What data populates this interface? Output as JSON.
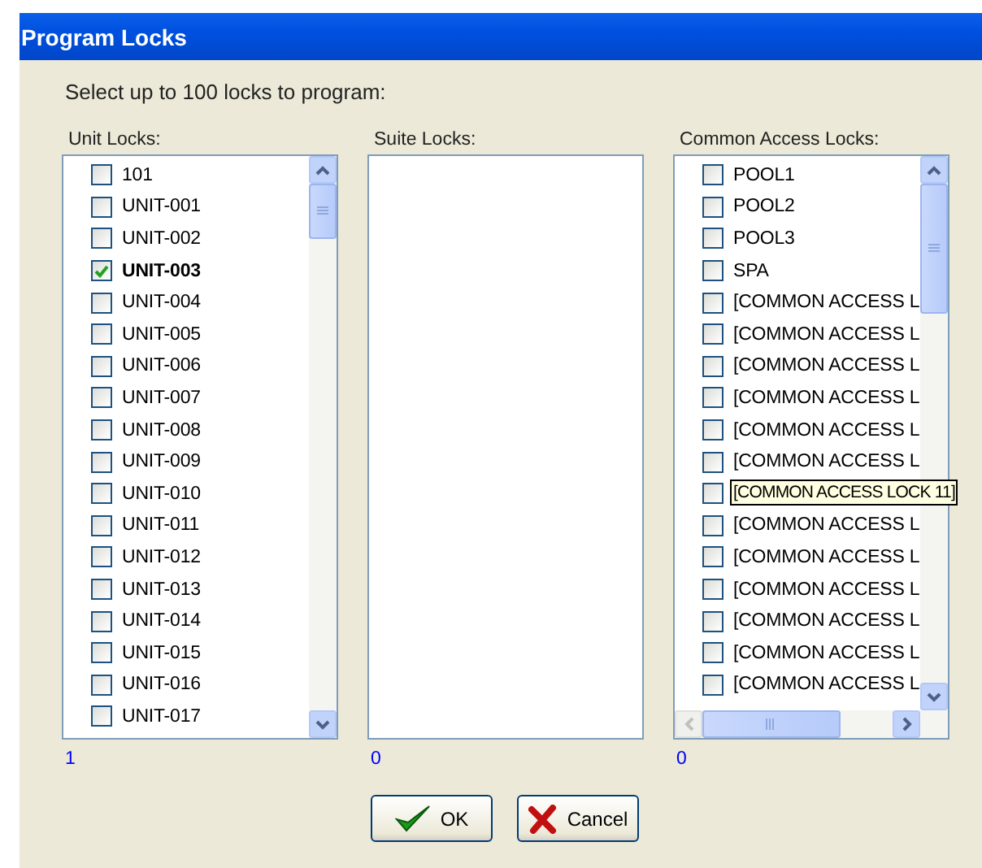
{
  "window": {
    "title": "Program Locks"
  },
  "prompt": "Select up to 100 locks to program:",
  "lists": [
    {
      "label": "Unit Locks:",
      "count": "1",
      "scrollbar": true,
      "horizontal_scrollbar": false,
      "items": [
        {
          "label": "101",
          "checked": false
        },
        {
          "label": "UNIT-001",
          "checked": false
        },
        {
          "label": "UNIT-002",
          "checked": false
        },
        {
          "label": "UNIT-003",
          "checked": true
        },
        {
          "label": "UNIT-004",
          "checked": false
        },
        {
          "label": "UNIT-005",
          "checked": false
        },
        {
          "label": "UNIT-006",
          "checked": false
        },
        {
          "label": "UNIT-007",
          "checked": false
        },
        {
          "label": "UNIT-008",
          "checked": false
        },
        {
          "label": "UNIT-009",
          "checked": false
        },
        {
          "label": "UNIT-010",
          "checked": false
        },
        {
          "label": "UNIT-011",
          "checked": false
        },
        {
          "label": "UNIT-012",
          "checked": false
        },
        {
          "label": "UNIT-013",
          "checked": false
        },
        {
          "label": "UNIT-014",
          "checked": false
        },
        {
          "label": "UNIT-015",
          "checked": false
        },
        {
          "label": "UNIT-016",
          "checked": false
        },
        {
          "label": "UNIT-017",
          "checked": false
        }
      ]
    },
    {
      "label": "Suite Locks:",
      "count": "0",
      "scrollbar": false,
      "horizontal_scrollbar": false
    },
    {
      "label": "Common Access Locks:",
      "count": "0",
      "scrollbar": true,
      "horizontal_scrollbar": true,
      "items": [
        {
          "label": "POOL1",
          "checked": false
        },
        {
          "label": "POOL2",
          "checked": false
        },
        {
          "label": "POOL3",
          "checked": false
        },
        {
          "label": "SPA",
          "checked": false
        },
        {
          "label": "[COMMON ACCESS L",
          "checked": false
        },
        {
          "label": "[COMMON ACCESS L",
          "checked": false
        },
        {
          "label": "[COMMON ACCESS L",
          "checked": false
        },
        {
          "label": "[COMMON ACCESS L",
          "checked": false
        },
        {
          "label": "[COMMON ACCESS L",
          "checked": false
        },
        {
          "label": "[COMMON ACCESS L",
          "checked": false
        },
        {
          "tooltip": "[COMMON ACCESS LOCK 11]",
          "checked": false
        },
        {
          "label": "[COMMON ACCESS L",
          "checked": false
        },
        {
          "label": "[COMMON ACCESS L",
          "checked": false
        },
        {
          "label": "[COMMON ACCESS L",
          "checked": false
        },
        {
          "label": "[COMMON ACCESS L",
          "checked": false
        },
        {
          "label": "[COMMON ACCESS L",
          "checked": false
        },
        {
          "label": "[COMMON ACCESS L",
          "checked": false
        }
      ]
    }
  ],
  "buttons": [
    {
      "label": "OK",
      "kind": "ok"
    },
    {
      "label": "Cancel",
      "kind": "cancel"
    }
  ]
}
